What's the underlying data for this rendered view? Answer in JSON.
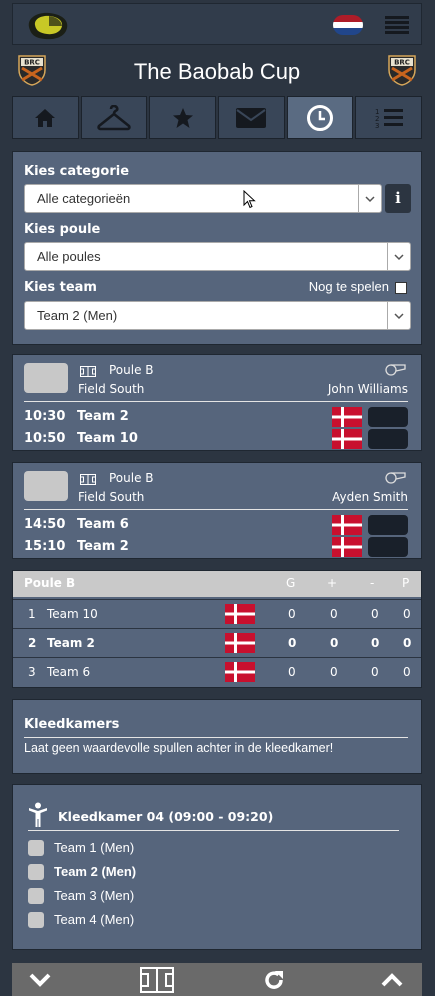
{
  "app": {
    "title": "The Baobab Cup",
    "crest_text": "BRC"
  },
  "colors": {
    "background": "#2c3541",
    "panel": "#56657c",
    "nav_active": "#5a6b82",
    "logo": "#c8c826"
  },
  "nav": [
    {
      "icon": "home-icon"
    },
    {
      "icon": "hanger-icon"
    },
    {
      "icon": "star-icon"
    },
    {
      "icon": "envelope-icon"
    },
    {
      "icon": "clock-icon",
      "active": true
    },
    {
      "icon": "numbered-list-icon"
    }
  ],
  "filters": {
    "category_label": "Kies categorie",
    "category_value": "Alle categorieën",
    "info_label": "i",
    "poule_label": "Kies poule",
    "poule_value": "Alle poules",
    "team_label": "Kies team",
    "team_value": "Team 2 (Men)",
    "unplayed_label": "Nog te spelen"
  },
  "matches": [
    {
      "poule": "Poule B",
      "field": "Field South",
      "referee": "John Williams",
      "games": [
        {
          "time": "10:30",
          "team": "Team 2"
        },
        {
          "time": "10:50",
          "team": "Team 10"
        }
      ]
    },
    {
      "poule": "Poule B",
      "field": "Field South",
      "referee": "Ayden Smith",
      "games": [
        {
          "time": "14:50",
          "team": "Team 6"
        },
        {
          "time": "15:10",
          "team": "Team 2"
        }
      ]
    }
  ],
  "standings": {
    "title": "Poule B",
    "headers": [
      "G",
      "+",
      "-",
      "P"
    ],
    "rows": [
      {
        "rank": "1",
        "team": "Team 10",
        "g": "0",
        "plus": "0",
        "minus": "0",
        "p": "0"
      },
      {
        "rank": "2",
        "team": "Team 2",
        "g": "0",
        "plus": "0",
        "minus": "0",
        "p": "0"
      },
      {
        "rank": "3",
        "team": "Team 6",
        "g": "0",
        "plus": "0",
        "minus": "0",
        "p": "0"
      }
    ]
  },
  "notice": {
    "title": "Kleedkamers",
    "text": "Laat geen waardevolle spullen achter in de kleedkamer!"
  },
  "kleedkamer": {
    "title": "Kleedkamer 04 (09:00 - 09:20)",
    "items": [
      "Team 1 (Men)",
      "Team 2 (Men)",
      "Team 3 (Men)",
      "Team 4 (Men)"
    ]
  }
}
